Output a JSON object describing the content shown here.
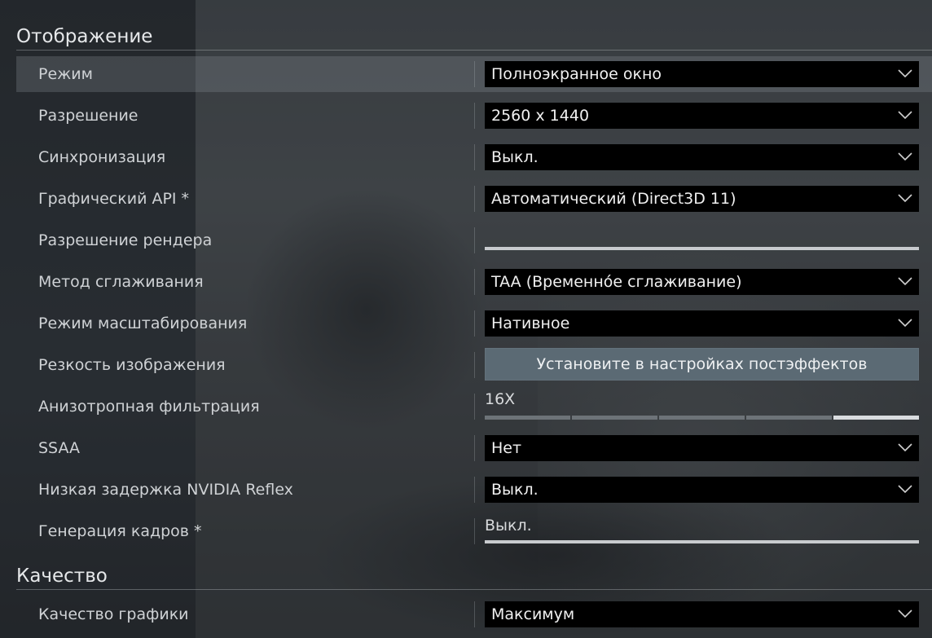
{
  "sections": {
    "display": "Отображение",
    "quality": "Качество"
  },
  "rows": {
    "mode": {
      "label": "Режим",
      "value": "Полноэкранное окно"
    },
    "resolution": {
      "label": "Разрешение",
      "value": "2560 x 1440"
    },
    "vsync": {
      "label": "Синхронизация",
      "value": "Выкл."
    },
    "graphics_api": {
      "label": "Графический API *",
      "value": "Автоматический (Direct3D 11)"
    },
    "render_resolution": {
      "label": "Разрешение рендера",
      "level": 1.0
    },
    "antialiasing": {
      "label": "Метод сглаживания",
      "value": "TAA (Временнóе сглаживание)"
    },
    "scaling_mode": {
      "label": "Режим масштабирования",
      "value": "Нативное"
    },
    "sharpness": {
      "label": "Резкость изображения",
      "button": "Установите в настройках постэффектов"
    },
    "anisotropic": {
      "label": "Анизотропная фильтрация",
      "value": "16X",
      "steps": 5,
      "selected_step": 5
    },
    "ssaa": {
      "label": "SSAA",
      "value": "Нет"
    },
    "reflex": {
      "label": "Низкая задержка NVIDIA Reflex",
      "value": "Выкл."
    },
    "frame_gen": {
      "label": "Генерация кадров *",
      "value": "Выкл."
    },
    "graphics_quality": {
      "label": "Качество графики",
      "value": "Максимум"
    }
  },
  "icons": {
    "dropdown": "chevron-down-icon"
  },
  "colors": {
    "dropdown_bg": "#000000",
    "button_bg": "#5b6a74",
    "selected_row": "#6e757c"
  }
}
